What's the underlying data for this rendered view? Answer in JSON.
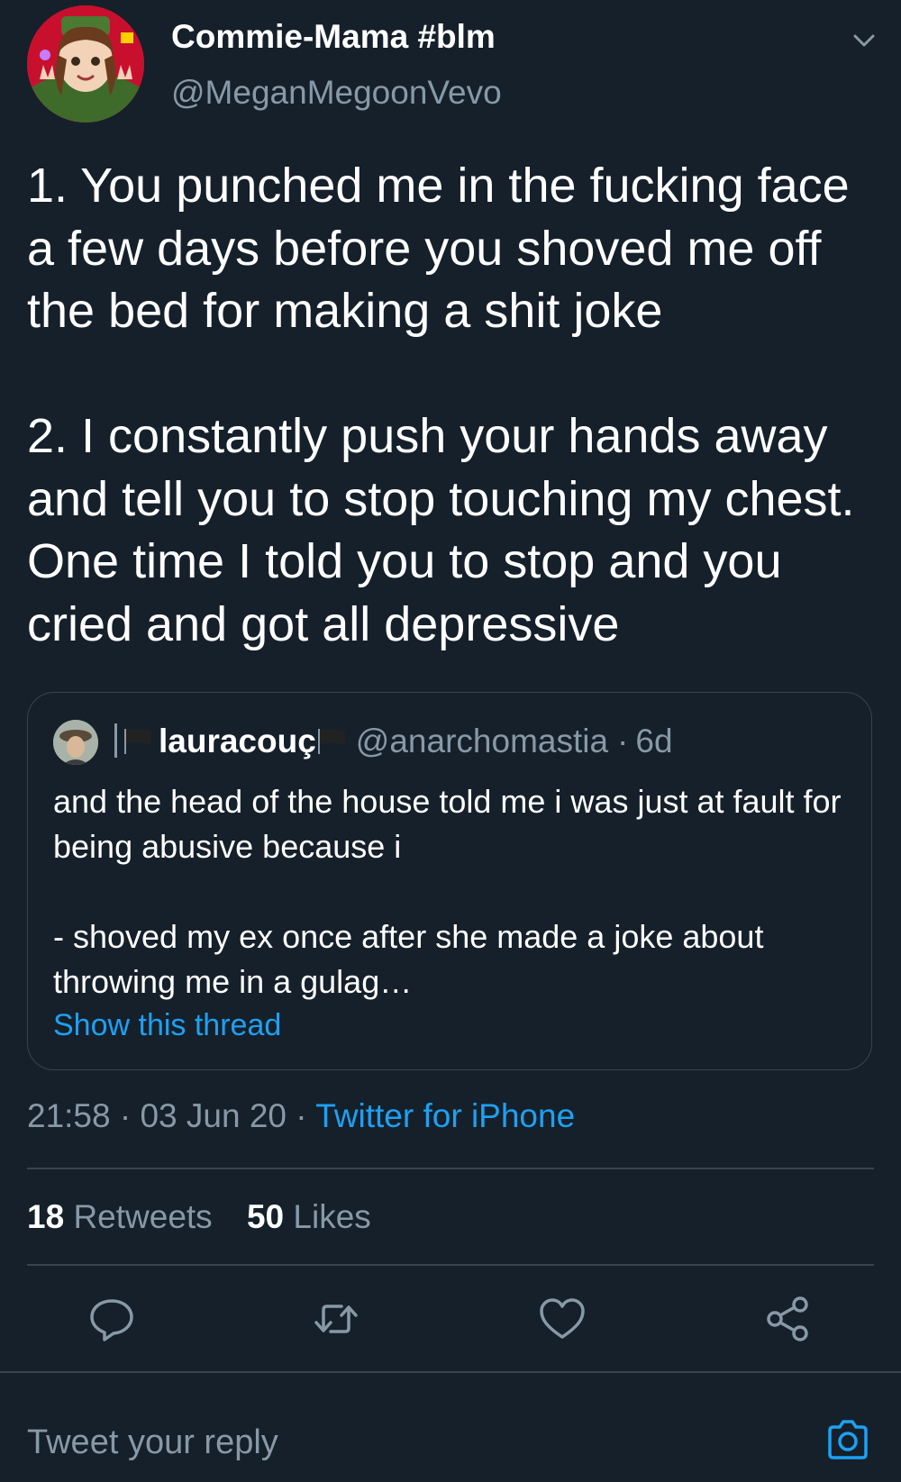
{
  "tweet": {
    "display_name": "Commie-Mama #blm",
    "handle": "@MeganMegoonVevo",
    "text": "1. You punched me in the fucking face a few days before you shoved me off the bed for making a shit joke\n\n2. I constantly push your hands away and tell you to stop touching my chest. One time I told you to stop and you cried and got all depressive",
    "time": "21:58",
    "date": "03 Jun 20",
    "source": "Twitter for iPhone",
    "separator": "·"
  },
  "quoted_tweet": {
    "display_name": "lauracouç",
    "handle": "@anarchomastia",
    "age": "6d",
    "text": "and the head of the house told me i was just at fault for being abusive because i\n\n- shoved my ex once after she made a joke about throwing me in a gulag…",
    "show_thread_label": "Show this thread"
  },
  "stats": {
    "retweets_count": "18",
    "retweets_label": "Retweets",
    "likes_count": "50",
    "likes_label": "Likes"
  },
  "actions": [
    "reply-icon",
    "retweet-icon",
    "like-icon",
    "share-icon"
  ],
  "reply": {
    "placeholder": "Tweet your reply"
  },
  "colors": {
    "background": "#15202b",
    "accent": "#1da1f2",
    "secondary_text": "#8899a6",
    "border": "#38444d"
  }
}
